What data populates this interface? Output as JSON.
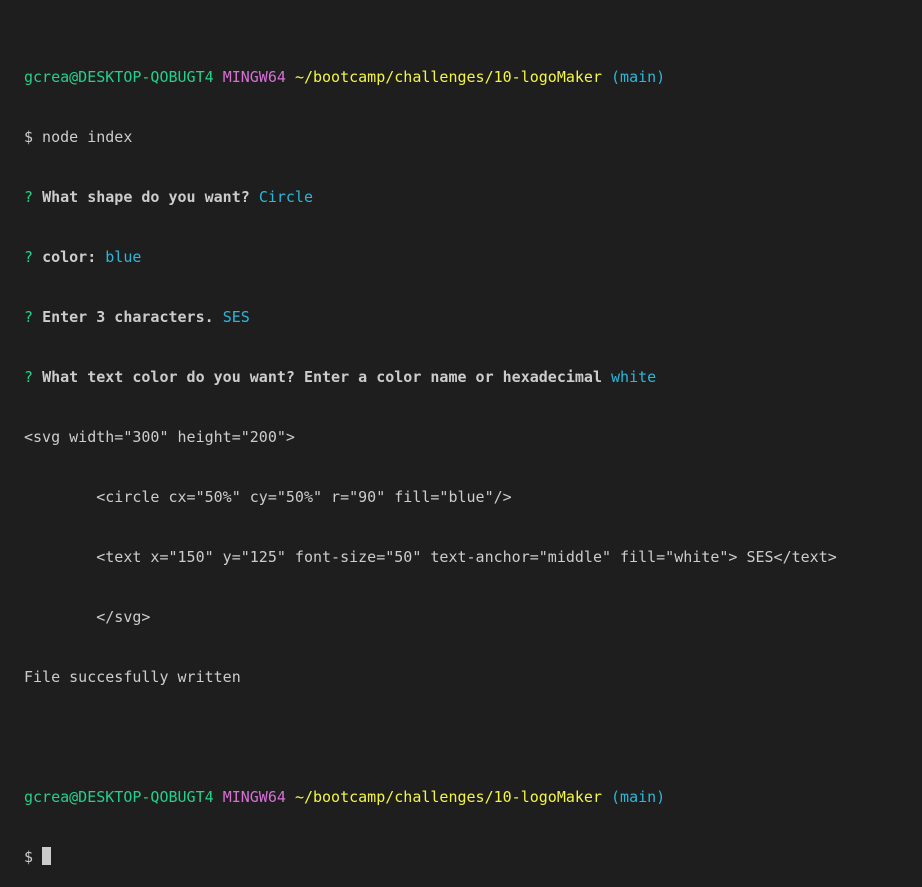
{
  "colors": {
    "background": "#1e1e1e",
    "text": "#cccccc",
    "user_host": "#23d18b",
    "env": "#d670d6",
    "path": "#f5f543",
    "branch": "#29b8db",
    "question_mark": "#23d18b",
    "answer": "#29b8db"
  },
  "prompt1": {
    "user_host": "gcrea@DESKTOP-QOBUGT4",
    "env": "MINGW64",
    "path": "~/bootcamp/challenges/10-logoMaker",
    "branch": "(main)"
  },
  "command": "$ node index",
  "questions": [
    {
      "mark": "?",
      "question": "What shape do you want?",
      "answer": "Circle"
    },
    {
      "mark": "?",
      "question": "color:",
      "answer": "blue"
    },
    {
      "mark": "?",
      "question": "Enter 3 characters.",
      "answer": "SES"
    },
    {
      "mark": "?",
      "question": "What text color do you want? Enter a color name or hexadecimal",
      "answer": "white"
    }
  ],
  "output_lines": [
    "<svg width=\"300\" height=\"200\">",
    "        <circle cx=\"50%\" cy=\"50%\" r=\"90\" fill=\"blue\"/>",
    "        <text x=\"150\" y=\"125\" font-size=\"50\" text-anchor=\"middle\" fill=\"white\"> SES</text>",
    "        </svg>",
    "File succesfully written"
  ],
  "prompt2": {
    "user_host": "gcrea@DESKTOP-QOBUGT4",
    "env": "MINGW64",
    "path": "~/bootcamp/challenges/10-logoMaker",
    "branch": "(main)"
  },
  "input_prompt": "$ "
}
